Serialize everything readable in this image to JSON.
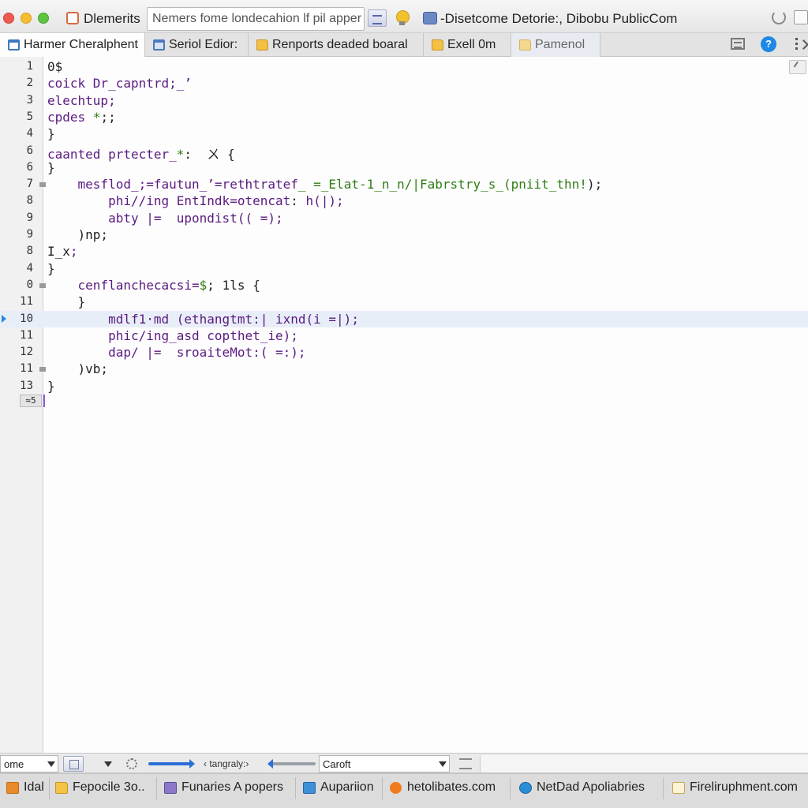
{
  "titlebar": {
    "app_title": "Dlemerits",
    "url_value": "Nemers fome londecahion lf pil apper",
    "window_title": "-Disetcome Detorie:, Dibobu PublicCom"
  },
  "tabs": [
    {
      "label": "Harmer Cheralphent",
      "icon": "doc-icon"
    },
    {
      "label": "Seriol Edior:",
      "icon": "window-icon"
    },
    {
      "label": "Renports deaded boaral",
      "icon": "folder-icon"
    },
    {
      "label": "Exell 0m",
      "icon": "folder-icon"
    },
    {
      "label": "Pamenol",
      "icon": "folder-icon"
    }
  ],
  "editor": {
    "lines": [
      {
        "num": "1",
        "segments": [
          {
            "t": "0$",
            "c": "dark"
          }
        ]
      },
      {
        "num": "2",
        "segments": [
          {
            "t": "coick Dr_capntrd;_’",
            "c": "purple"
          }
        ]
      },
      {
        "num": "3",
        "segments": [
          {
            "t": "elechtup;",
            "c": "purple"
          }
        ]
      },
      {
        "num": "5",
        "segments": [
          {
            "t": "cpdes ",
            "c": "purple"
          },
          {
            "t": "*",
            "c": "green"
          },
          {
            "t": ";;",
            "c": "dark"
          }
        ]
      },
      {
        "num": "4",
        "segments": [
          {
            "t": "}",
            "c": "dark"
          }
        ]
      },
      {
        "num": "6",
        "segments": [
          {
            "t": "caanted prtecter_",
            "c": "purple"
          },
          {
            "t": "*",
            "c": "green"
          },
          {
            "t": ":  ",
            "c": "dark"
          },
          {
            "t": "ㄨ",
            "c": "dark"
          },
          {
            "t": " {",
            "c": "dark"
          }
        ]
      },
      {
        "num": "6",
        "segments": [
          {
            "t": "}",
            "c": "dark"
          }
        ]
      },
      {
        "num": "7",
        "segments": [
          {
            "t": "    mesflod_;=fautun_’=rethtratef",
            "c": "purple"
          },
          {
            "t": "_ =_Elat-1_n_n/|Fabrstry_s_(pniit_thn!",
            "c": "green"
          },
          {
            "t": ");",
            "c": "dark"
          }
        ]
      },
      {
        "num": "8",
        "segments": [
          {
            "t": "        phi//ing EntIndk=otencat",
            "c": "purple"
          },
          {
            "t": ": ",
            "c": "dark"
          },
          {
            "t": "h(|);",
            "c": "purple"
          }
        ]
      },
      {
        "num": "9",
        "segments": [
          {
            "t": "        abty |=  upondist(( =);",
            "c": "purple"
          }
        ]
      },
      {
        "num": "9",
        "segments": [
          {
            "t": "    )np;",
            "c": "dark"
          }
        ]
      },
      {
        "num": "8",
        "segments": [
          {
            "t": "I_x",
            "c": "dark"
          },
          {
            "t": ";",
            "c": "purple"
          }
        ]
      },
      {
        "num": "4",
        "segments": [
          {
            "t": "}",
            "c": "dark"
          }
        ]
      },
      {
        "num": "0",
        "segments": [
          {
            "t": "    cenflanchecacsi=",
            "c": "purple"
          },
          {
            "t": "$",
            "c": "green"
          },
          {
            "t": "; 1ls {",
            "c": "dark"
          }
        ]
      },
      {
        "num": "11",
        "segments": [
          {
            "t": "    }",
            "c": "dark"
          }
        ]
      },
      {
        "num": "10",
        "segments": [
          {
            "t": "        mdlf1·md (ethangtmt:| ",
            "c": "purple"
          },
          {
            "t": "ixnd",
            "c": "purple"
          },
          {
            "t": "(i =|);",
            "c": "purple"
          }
        ]
      },
      {
        "num": "11",
        "segments": [
          {
            "t": "        phic/ing_asd copthet_ie);",
            "c": "purple"
          }
        ]
      },
      {
        "num": "12",
        "segments": [
          {
            "t": "        dap/ |=  sroaiteMot:( =:);",
            "c": "purple"
          }
        ]
      },
      {
        "num": "11",
        "segments": [
          {
            "t": "    )vb;",
            "c": "dark"
          }
        ]
      },
      {
        "num": "13",
        "segments": [
          {
            "t": "}",
            "c": "dark"
          }
        ]
      }
    ],
    "cursor_label": "≈5"
  },
  "statusbar": {
    "select1_value": "ome",
    "status_label": "‹ tangraly:›",
    "select2_value": "Caroft"
  },
  "bookmarks": [
    {
      "label": "Idal",
      "icon": "orange"
    },
    {
      "label": "Fepocile 3o..",
      "icon": "folder"
    },
    {
      "label": "Funaries A popers",
      "icon": "purple"
    },
    {
      "label": "Aupariion",
      "icon": "blue"
    },
    {
      "label": "hetolibates.com",
      "icon": "gear"
    },
    {
      "label": "NetDad Apoliabries",
      "icon": "globe"
    },
    {
      "label": "Fireliruphment.com",
      "icon": "page"
    }
  ]
}
